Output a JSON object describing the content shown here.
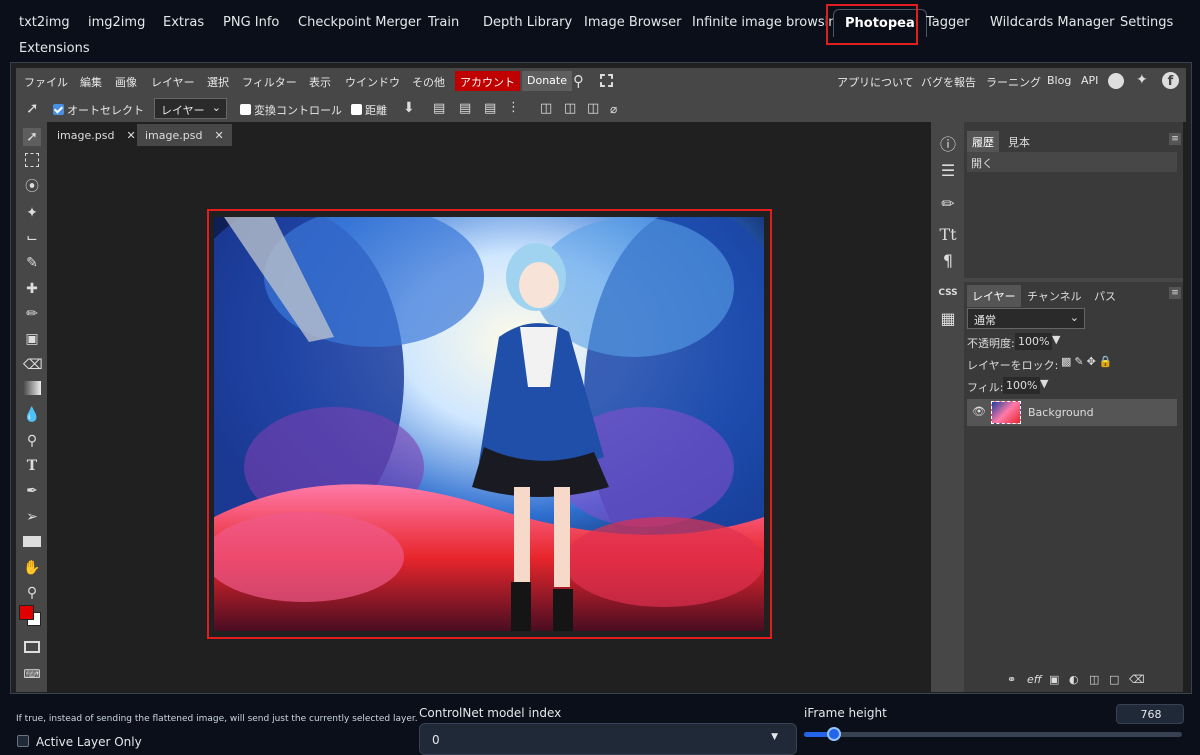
{
  "tabs": [
    "txt2img",
    "img2img",
    "Extras",
    "PNG Info",
    "Checkpoint Merger",
    "Train",
    "Depth Library",
    "Image Browser",
    "Infinite image browsing",
    "Photopea",
    "Tagger",
    "Wildcards Manager",
    "Settings",
    "Extensions"
  ],
  "active_tab": "Photopea",
  "menu": {
    "items": [
      "ファイル",
      "編集",
      "画像",
      "レイヤー",
      "選択",
      "フィルター",
      "表示",
      "ウインドウ",
      "その他"
    ],
    "account": "アカウント",
    "donate": "Donate",
    "right": [
      "アプリについて",
      "バグを報告",
      "ラーニング",
      "Blog",
      "API"
    ]
  },
  "options": {
    "autoselect": "オートセレクト",
    "target_select": "レイヤー",
    "transform": "変換コントロール",
    "distance": "距離"
  },
  "doc_tabs": [
    "image.psd",
    "image.psd"
  ],
  "history": {
    "tabs": [
      "履歴",
      "見本"
    ],
    "items": [
      "開く"
    ]
  },
  "layers": {
    "tabs": [
      "レイヤー",
      "チャンネル",
      "パス"
    ],
    "blend_mode": "通常",
    "opacity_label": "不透明度:",
    "opacity": "100%",
    "lock_label": "レイヤーをロック:",
    "fill_label": "フィル:",
    "fill": "100%",
    "layer_name": "Background"
  },
  "bottom": {
    "note": "If true, instead of sending the flattened image, will send just the currently selected layer.",
    "active_layer_label": "Active Layer Only",
    "controlnet_label": "ControlNet model index",
    "controlnet_value": "0",
    "iframe_label": "iFrame height",
    "iframe_value": "768",
    "iframe_fraction": 0.08
  },
  "colors": {
    "accent": "#e11d1d",
    "slider": "#2563eb",
    "account": "#c00000"
  }
}
